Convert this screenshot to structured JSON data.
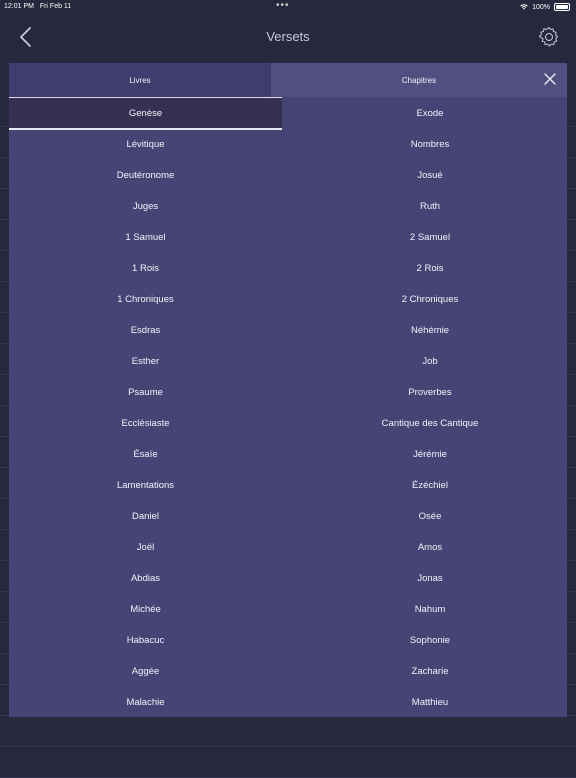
{
  "status_bar": {
    "time": "12:01 PM",
    "date": "Fri Feb 11",
    "battery": "100%"
  },
  "nav": {
    "title": "Versets"
  },
  "tabs": {
    "books": "Livres",
    "chapters": "Chapitres"
  },
  "selected_book": "Genèse",
  "books": [
    [
      "Genèse",
      "Exode"
    ],
    [
      "Lévitique",
      "Nombres"
    ],
    [
      "Deutéronome",
      "Josué"
    ],
    [
      "Juges",
      "Ruth"
    ],
    [
      "1 Samuel",
      "2 Samuel"
    ],
    [
      "1 Rois",
      "2 Rois"
    ],
    [
      "1 Chroniques",
      "2 Chroniques"
    ],
    [
      "Esdras",
      "Néhémie"
    ],
    [
      "Esther",
      "Job"
    ],
    [
      "Psaume",
      "Proverbes"
    ],
    [
      "Ecclésiaste",
      "Cantique des Cantique"
    ],
    [
      "Ésaïe",
      "Jérémie"
    ],
    [
      "Lamentations",
      "Ézéchiel"
    ],
    [
      "Daniel",
      "Osée"
    ],
    [
      "Joël",
      "Amos"
    ],
    [
      "Abdias",
      "Jonas"
    ],
    [
      "Michée",
      "Nahum"
    ],
    [
      "Habacuc",
      "Sophonie"
    ],
    [
      "Aggée",
      "Zacharie"
    ],
    [
      "Malachie",
      "Matthieu"
    ]
  ],
  "colors": {
    "modal": "#464475",
    "background": "#27273d",
    "selected": "#343152"
  },
  "icons": {
    "back": "chevron-left-icon",
    "settings": "gear-icon",
    "close": "close-icon"
  }
}
